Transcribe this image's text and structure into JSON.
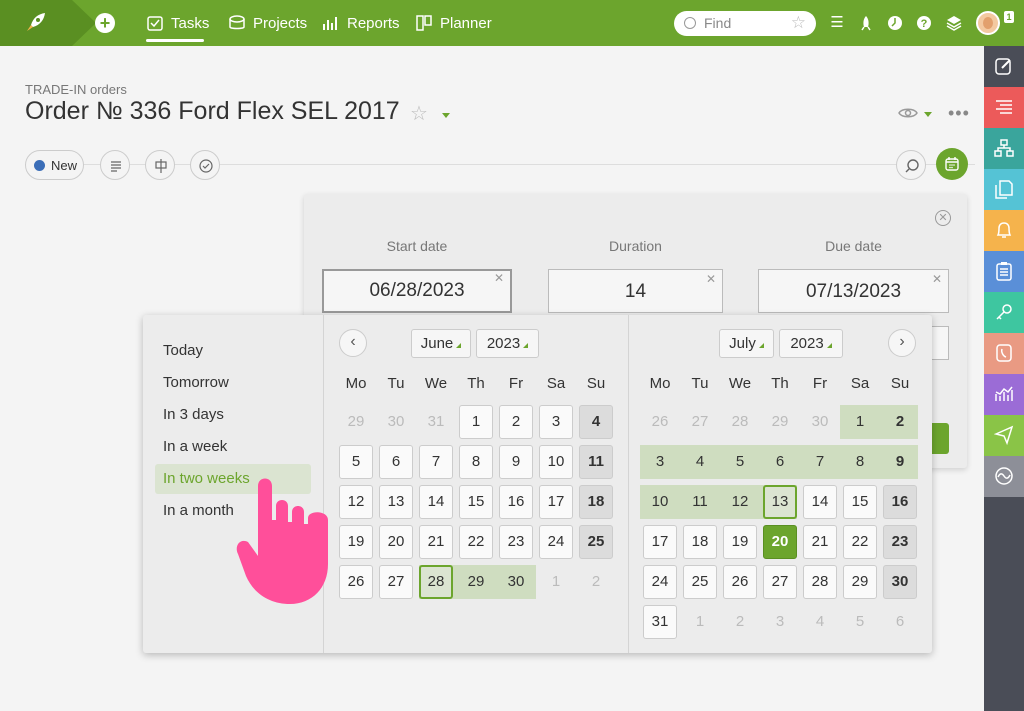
{
  "topbar": {
    "nav": [
      {
        "label": "Tasks",
        "icon": "tasks-icon",
        "active": true
      },
      {
        "label": "Projects",
        "icon": "projects-icon",
        "active": false
      },
      {
        "label": "Reports",
        "icon": "reports-icon",
        "active": false
      },
      {
        "label": "Planner",
        "icon": "planner-icon",
        "active": false
      }
    ],
    "search_placeholder": "Find",
    "avatar_badge": "1"
  },
  "page": {
    "breadcrumb": "TRADE-IN orders",
    "title": "Order № 336 Ford Flex SEL 2017",
    "status": "New"
  },
  "dates": {
    "start_label": "Start date",
    "start_value": "06/28/2023",
    "duration_label": "Duration",
    "duration_value": "14",
    "due_label": "Due date",
    "due_value": "07/13/2023"
  },
  "quick_picks": [
    "Today",
    "Tomorrow",
    "In 3 days",
    "In a week",
    "In two weeks",
    "In a month"
  ],
  "quick_selected": "In two weeks",
  "calendar": {
    "weekdays": [
      "Mo",
      "Tu",
      "We",
      "Th",
      "Fr",
      "Sa",
      "Su"
    ],
    "left": {
      "month": "June",
      "year": "2023",
      "days": [
        "29",
        "30",
        "31",
        "1",
        "2",
        "3",
        "4",
        "5",
        "6",
        "7",
        "8",
        "9",
        "10",
        "11",
        "12",
        "13",
        "14",
        "15",
        "16",
        "17",
        "18",
        "19",
        "20",
        "21",
        "22",
        "23",
        "24",
        "25",
        "26",
        "27",
        "28",
        "29",
        "30",
        "1",
        "2"
      ]
    },
    "right": {
      "month": "July",
      "year": "2023",
      "days": [
        "26",
        "27",
        "28",
        "29",
        "30",
        "1",
        "2",
        "3",
        "4",
        "5",
        "6",
        "7",
        "8",
        "9",
        "10",
        "11",
        "12",
        "13",
        "14",
        "15",
        "16",
        "17",
        "18",
        "19",
        "20",
        "21",
        "22",
        "23",
        "24",
        "25",
        "26",
        "27",
        "28",
        "29",
        "30",
        "31",
        "1",
        "2",
        "3",
        "4",
        "5",
        "6"
      ]
    }
  },
  "colors": {
    "brand_green": "#6ca52d",
    "range_green": "#cfddc0",
    "status_blue": "#3b6eb8",
    "sidebar_dark": "#4a4d57",
    "cursor_pink": "#ff4f9a"
  },
  "right_sidebar": [
    {
      "name": "edit-icon",
      "color": "#4a4d57"
    },
    {
      "name": "list-icon",
      "color": "#ec5a5a"
    },
    {
      "name": "structure-icon",
      "color": "#3aa59c"
    },
    {
      "name": "documents-icon",
      "color": "#55c3d5"
    },
    {
      "name": "bell-icon",
      "color": "#f5b34c"
    },
    {
      "name": "clipboard-icon",
      "color": "#5a8fd8"
    },
    {
      "name": "key-icon",
      "color": "#3ec6a0"
    },
    {
      "name": "phone-icon",
      "color": "#e99a83"
    },
    {
      "name": "chart-icon",
      "color": "#9b6cd6"
    },
    {
      "name": "send-icon",
      "color": "#8ac447"
    },
    {
      "name": "integration-icon",
      "color": "#8d8f98"
    }
  ]
}
